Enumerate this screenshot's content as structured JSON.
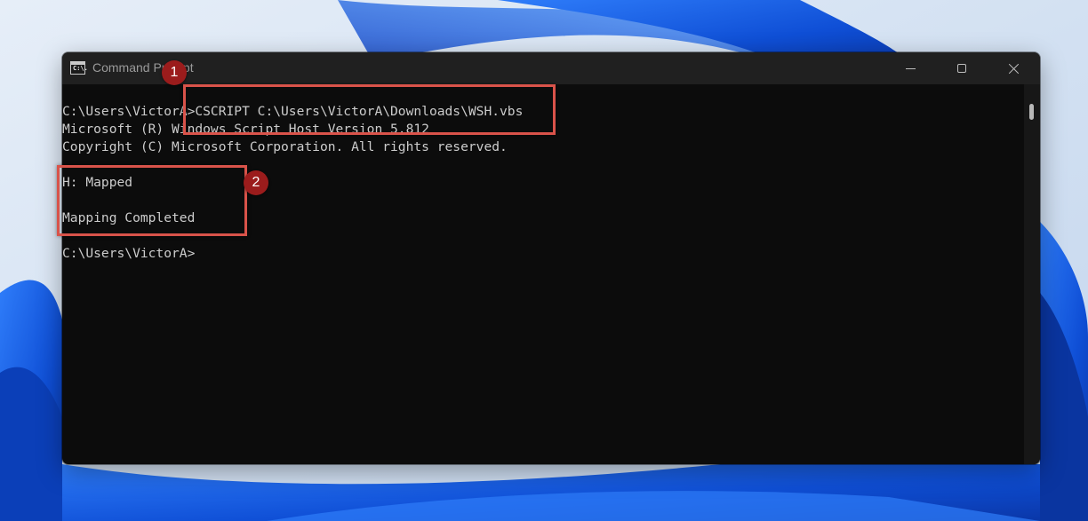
{
  "window": {
    "title": "Command Prompt",
    "icon_text": "C:\\.",
    "icon": "command-prompt-icon",
    "controls": [
      "minimize-icon",
      "maximize-icon",
      "close-icon"
    ]
  },
  "console": {
    "lines": [
      "C:\\Users\\VictorA>CSCRIPT C:\\Users\\VictorA\\Downloads\\WSH.vbs",
      "Microsoft (R) Windows Script Host Version 5.812",
      "Copyright (C) Microsoft Corporation. All rights reserved.",
      "",
      "H: Mapped",
      "",
      "Mapping Completed",
      "",
      "C:\\Users\\VictorA>"
    ]
  },
  "annotations": {
    "badge_1": "1",
    "badge_2": "2",
    "color": "#d9534a",
    "badge_color": "#9b1c1c"
  }
}
